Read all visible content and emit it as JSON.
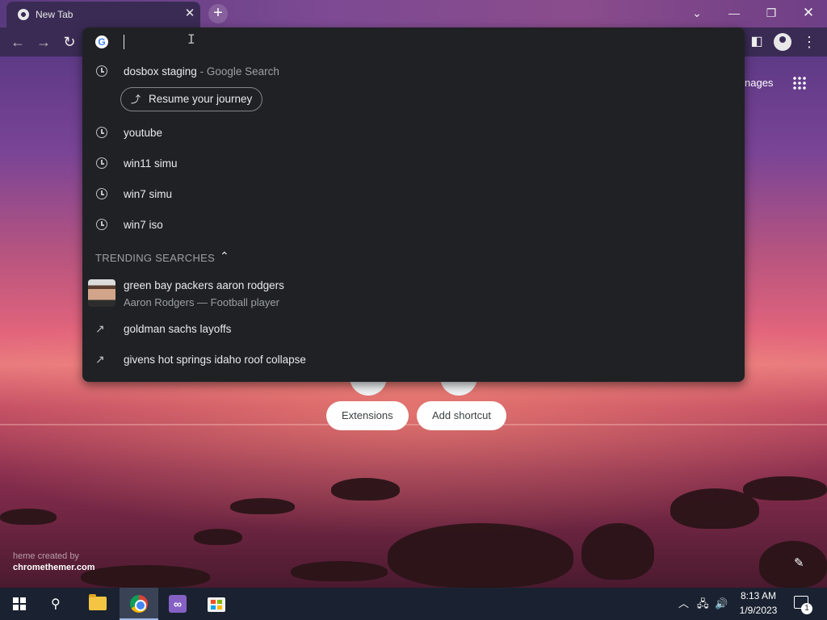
{
  "window": {
    "tab_title": "New Tab",
    "tab_icon": "chrome-icon",
    "controls": [
      "tab-search-icon",
      "minimize-icon",
      "restore-icon",
      "close-icon"
    ]
  },
  "omnibox": {
    "value": "",
    "suggestions": [
      {
        "text": "dosbox staging",
        "suffix": " - Google Search",
        "icon": "history-icon"
      },
      {
        "text": "youtube",
        "icon": "history-icon"
      },
      {
        "text": "win11 simu",
        "icon": "history-icon"
      },
      {
        "text": "win7 simu",
        "icon": "history-icon"
      },
      {
        "text": "win7 iso",
        "icon": "history-icon"
      }
    ],
    "journey_chip": "Resume your journey",
    "trending_header": "TRENDING SEARCHES",
    "trending": [
      {
        "text": "green bay packers aaron rodgers",
        "subtitle": "Aaron Rodgers — Football player",
        "icon": "entity-thumbnail"
      },
      {
        "text": "goldman sachs layoffs",
        "icon": "trending-icon"
      },
      {
        "text": "givens hot springs idaho roof collapse",
        "icon": "trending-icon"
      }
    ]
  },
  "ntp": {
    "images_link": "nages",
    "shortcuts": [
      "Extensions",
      "Add shortcut"
    ],
    "theme_credit_prefix": "heme created by",
    "theme_credit_brand": "chromethemer.com"
  },
  "taskbar": {
    "apps": [
      "start-icon",
      "search-icon",
      "file-explorer-icon",
      "chrome-icon",
      "visual-studio-icon",
      "store-icon"
    ],
    "time": "8:13 AM",
    "date": "1/9/2023",
    "notification_count": "1"
  }
}
